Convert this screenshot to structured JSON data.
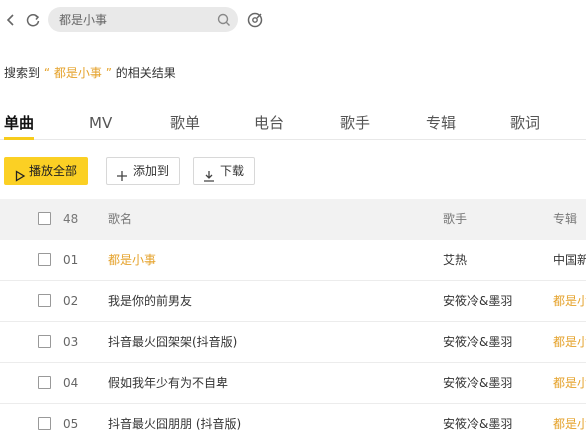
{
  "search": {
    "value": "都是小事"
  },
  "result": {
    "prefix": "搜索到",
    "open_quote": "“",
    "keyword": "都是小事",
    "close_quote": "”",
    "suffix": "的相关结果"
  },
  "tabs": [
    "单曲",
    "MV",
    "歌单",
    "电台",
    "歌手",
    "专辑",
    "歌词"
  ],
  "actions": {
    "play_all": "播放全部",
    "add_to": "添加到",
    "download": "下载"
  },
  "table": {
    "count": "48",
    "headers": {
      "title": "歌名",
      "singer": "歌手",
      "album": "专辑"
    },
    "rows": [
      {
        "num": "01",
        "title": "都是小事",
        "singer": "艾热",
        "album": "中国新"
      },
      {
        "num": "02",
        "title": "我是你的前男友",
        "singer": "安筱冷&墨羽",
        "album": "都是小"
      },
      {
        "num": "03",
        "title": "抖音最火囧架架(抖音版)",
        "singer": "安筱冷&墨羽",
        "album": "都是小"
      },
      {
        "num": "04",
        "title": "假如我年少有为不自卑",
        "singer": "安筱冷&墨羽",
        "album": "都是小"
      },
      {
        "num": "05",
        "title": "抖音最火囧朋朋 (抖音版)",
        "singer": "安筱冷&墨羽",
        "album": "都是小"
      }
    ]
  },
  "colors": {
    "accent": "#fbd024",
    "highlight": "#e5a22b"
  }
}
